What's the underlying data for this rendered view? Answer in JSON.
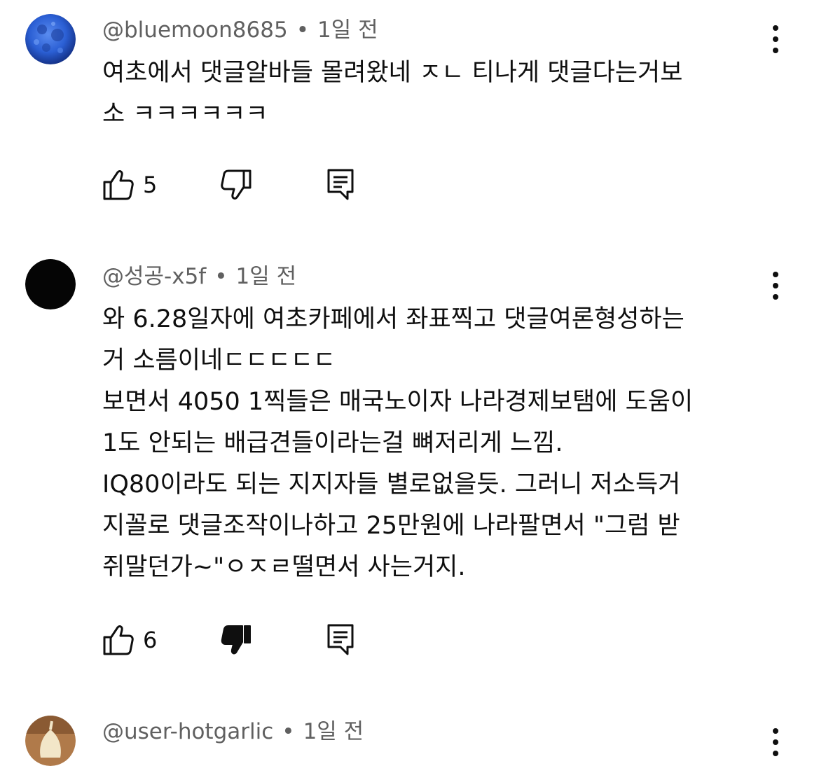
{
  "comments": [
    {
      "handle": "@bluemoon8685",
      "time": "1일 전",
      "lines": [
        "여초에서 댓글알바들 몰려왔네 ㅈㄴ 티나게 댓글다는거보",
        "소 ㅋㅋㅋㅋㅋㅋ"
      ],
      "likes": "5",
      "disliked": false
    },
    {
      "handle": "@성공-x5f",
      "time": "1일 전",
      "lines": [
        "와 6.28일자에 여초카페에서 좌표찍고 댓글여론형성하는",
        "거 소름이네ㄷㄷㄷㄷㄷ",
        "보면서 4050 1찍들은 매국노이자 나라경제보탬에 도움이",
        "1도 안되는 배급견들이라는걸 뼈저리게 느낌.",
        "IQ80이라도 되는 지지자들 별로없을듯. 그러니 저소득거",
        "지꼴로 댓글조작이나하고 25만원에 나라팔면서 \"그럼 받",
        "쥐말던가~\"ㅇㅈㄹ떨면서 사는거지."
      ],
      "likes": "6",
      "disliked": true
    },
    {
      "handle": "@user-hotgarlic",
      "time": "1일 전"
    }
  ],
  "separator": "•",
  "icons": {
    "like": "thumbs-up-icon",
    "dislike": "thumbs-down-icon",
    "reply": "reply-icon",
    "more": "more-vert-icon"
  },
  "colors": {
    "text": "#0f0f0f",
    "meta": "#606060"
  }
}
